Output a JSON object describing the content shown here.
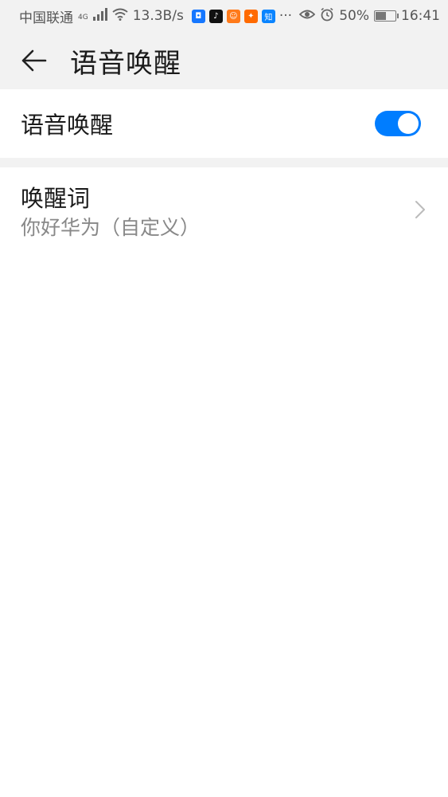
{
  "status_bar": {
    "carrier": "中国联通",
    "network_type": "4G",
    "speed": "13.3B/s",
    "more": "···",
    "battery": "50%",
    "time": "16:41",
    "apps": [
      {
        "name": "shield-app-icon",
        "color": "#1677ff",
        "glyph": "◘"
      },
      {
        "name": "tiktok-app-icon",
        "color": "#111111",
        "glyph": "♪"
      },
      {
        "name": "uc-app-icon",
        "color": "#ff7a1a",
        "glyph": "☺"
      },
      {
        "name": "taobao-app-icon",
        "color": "#ff6a00",
        "glyph": "✦"
      },
      {
        "name": "zhihu-app-icon",
        "color": "#0a84ff",
        "glyph": "知"
      }
    ]
  },
  "header": {
    "title": "语音唤醒",
    "back_icon": "arrow-left-icon"
  },
  "settings": {
    "voice_wake": {
      "label": "语音唤醒",
      "enabled": true,
      "accent": "#007dff"
    },
    "wake_word": {
      "title": "唤醒词",
      "value": "你好华为（自定义）",
      "chevron_icon": "chevron-right-icon"
    }
  }
}
